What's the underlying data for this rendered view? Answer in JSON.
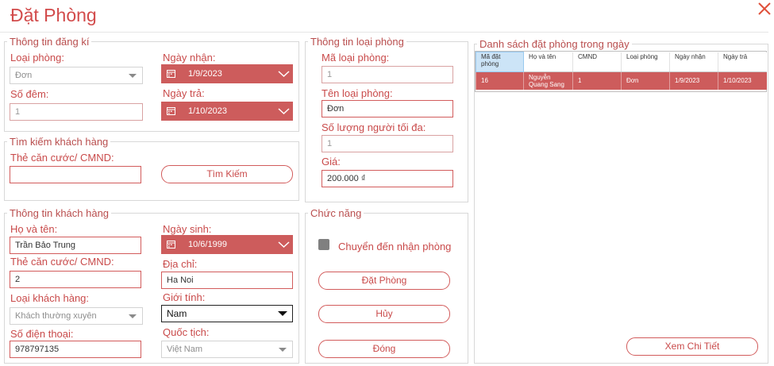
{
  "window": {
    "title": "Đặt Phòng"
  },
  "registration": {
    "legend": "Thông tin đăng kí",
    "room_type_label": "Loại phòng:",
    "room_type_value": "Đơn",
    "nights_label": "Số đêm:",
    "nights_value": "1",
    "checkin_label": "Ngày nhận:",
    "checkin_value": "1/9/2023",
    "checkout_label": "Ngày trả:",
    "checkout_value": "1/10/2023"
  },
  "search": {
    "legend": "Tìm kiếm khách hàng",
    "id_label": "Thẻ căn cước/ CMND:",
    "id_value": "",
    "button_label": "Tìm Kiếm"
  },
  "customer": {
    "legend": "Thông tin khách hàng",
    "name_label": "Họ và tên:",
    "name_value": "Trần Bảo Trung",
    "id_label": "Thẻ căn cước/ CMND:",
    "id_value": "2",
    "type_label": "Loại khách hàng:",
    "type_value": "Khách thường xuyên",
    "phone_label": "Số điện thoại:",
    "phone_value": "978797135",
    "dob_label": "Ngày sinh:",
    "dob_value": "10/6/1999",
    "address_label": "Địa chỉ:",
    "address_value": "Ha Noi",
    "gender_label": "Giới tính:",
    "gender_value": "Nam",
    "nationality_label": "Quốc tịch:",
    "nationality_value": "Việt Nam"
  },
  "room_info": {
    "legend": "Thông tin loại phòng",
    "code_label": "Mã loại phòng:",
    "code_value": "1",
    "name_label": "Tên loại phòng:",
    "name_value": "Đơn",
    "max_label": "Số lượng người tối đa:",
    "max_value": "1",
    "price_label": "Giá:",
    "price_value": "200.000 ₫"
  },
  "functions": {
    "legend": "Chức năng",
    "checkbox_label": "Chuyển đến nhận phòng",
    "book_button": "Đặt Phòng",
    "cancel_button": "Hủy",
    "close_button": "Đóng"
  },
  "bookings": {
    "legend": "Danh sách đặt phòng trong ngày",
    "headers": [
      "Mã đặt phòng",
      "Họ và tên",
      "CMND",
      "Loại phòng",
      "Ngày nhận",
      "Ngày trả"
    ],
    "rows": [
      [
        "16",
        "Nguyễn Quang Sang",
        "1",
        "Đơn",
        "1/9/2023",
        "1/10/2023"
      ]
    ],
    "details_button": "Xem Chi Tiết"
  },
  "colors": {
    "accent": "#cd5c5c",
    "text": "#c94a4a",
    "selected_header": "#cce4f7"
  },
  "icons": [
    "close-icon",
    "calendar-icon",
    "chevron-down-icon",
    "dropdown-arrow-icon"
  ]
}
